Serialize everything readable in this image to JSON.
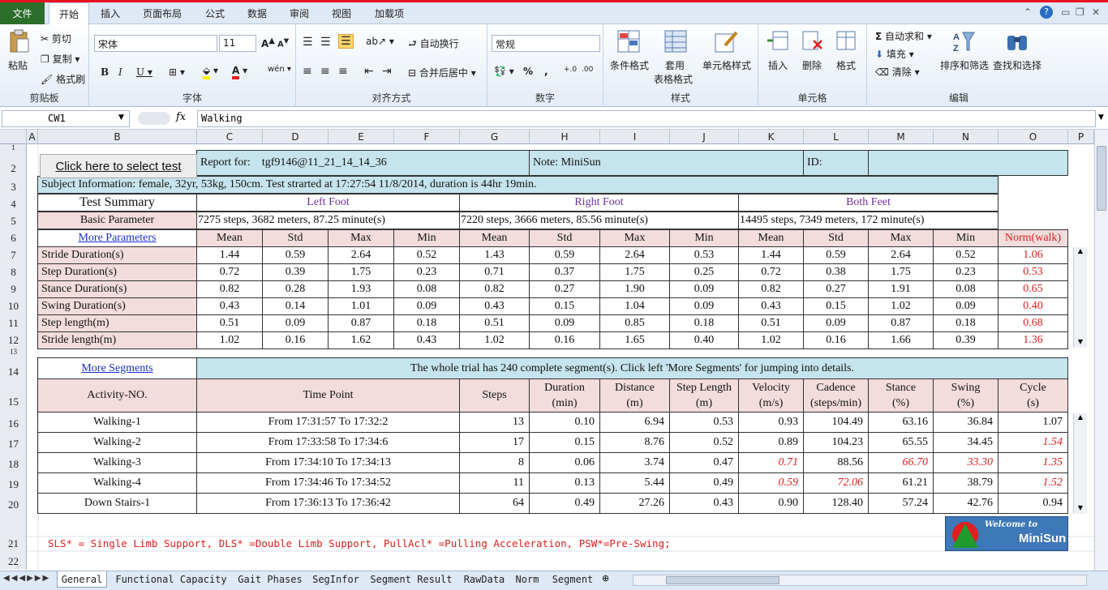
{
  "ribbon": {
    "file_tab": "文件",
    "tabs": [
      "开始",
      "插入",
      "页面布局",
      "公式",
      "数据",
      "审阅",
      "视图",
      "加载项"
    ],
    "clipboard": {
      "paste": "粘贴",
      "cut": "剪切",
      "copy": "复制",
      "format_painter": "格式刷",
      "group": "剪贴板"
    },
    "font": {
      "name": "宋体",
      "size": "11",
      "group": "字体"
    },
    "align": {
      "wrap": "自动换行",
      "merge": "合并后居中",
      "group": "对齐方式"
    },
    "number": {
      "format": "常规",
      "group": "数字"
    },
    "styles": {
      "cond": "条件格式",
      "table1": "套用",
      "table2": "表格格式",
      "cell": "单元格样式",
      "group": "样式"
    },
    "cells": {
      "insert": "插入",
      "delete": "删除",
      "format": "格式",
      "group": "单元格"
    },
    "editing": {
      "autosum": "自动求和",
      "fill": "填充",
      "clear": "清除",
      "sort": "排序和筛选",
      "find": "查找和选择",
      "group": "编辑"
    }
  },
  "formula_bar": {
    "name_box": "CW1",
    "fx": "fx",
    "value": "Walking"
  },
  "columns": [
    "A",
    "B",
    "C",
    "D",
    "E",
    "F",
    "G",
    "H",
    "I",
    "J",
    "K",
    "L",
    "M",
    "N",
    "O",
    "P"
  ],
  "rows": [
    "1",
    "2",
    "3",
    "4",
    "5",
    "6",
    "7",
    "8",
    "9",
    "10",
    "11",
    "12",
    "13",
    "14",
    "15",
    "16",
    "17",
    "18",
    "19",
    "20",
    "21",
    "22"
  ],
  "sheet": {
    "select_button": "Click here to select test",
    "report_for_label": "Report for:",
    "report_for_value": "tgf9146@11_21_14_14_36",
    "note": "Note: MiniSun",
    "id": "ID:",
    "subject_info": "Subject Information:  female, 32yr, 53kg, 150cm.   Test strarted at 17:27:54 11/8/2014, duration is  44hr 19min.",
    "test_summary": "Test Summary",
    "left_foot": "Left Foot",
    "right_foot": "Right Foot",
    "both_feet": "Both Feet",
    "basic_parameter": "Basic Parameter",
    "left_basic": "7275 steps, 3682 meters,  87.25 minute(s)",
    "right_basic": "7220 steps, 3666 meters, 85.56 minute(s)",
    "both_basic": "14495 steps, 7349 meters, 172 minute(s)",
    "more_parameters": "More Parameters",
    "stat_headers": [
      "Mean",
      "Std",
      "Max",
      "Min",
      "Mean",
      "Std",
      "Max",
      "Min",
      "Mean",
      "Std",
      "Max",
      "Min"
    ],
    "norm_header": "Norm(walk)",
    "params": [
      {
        "name": "Stride Duration(s)",
        "vals": [
          "1.44",
          "0.59",
          "2.64",
          "0.52",
          "1.43",
          "0.59",
          "2.64",
          "0.53",
          "1.44",
          "0.59",
          "2.64",
          "0.52"
        ],
        "norm": "1.06"
      },
      {
        "name": "Step Duration(s)",
        "vals": [
          "0.72",
          "0.39",
          "1.75",
          "0.23",
          "0.71",
          "0.37",
          "1.75",
          "0.25",
          "0.72",
          "0.38",
          "1.75",
          "0.23"
        ],
        "norm": "0.53"
      },
      {
        "name": "Stance Duration(s)",
        "vals": [
          "0.82",
          "0.28",
          "1.93",
          "0.08",
          "0.82",
          "0.27",
          "1.90",
          "0.09",
          "0.82",
          "0.27",
          "1.91",
          "0.08"
        ],
        "norm": "0.65"
      },
      {
        "name": "Swing Duration(s)",
        "vals": [
          "0.43",
          "0.14",
          "1.01",
          "0.09",
          "0.43",
          "0.15",
          "1.04",
          "0.09",
          "0.43",
          "0.15",
          "1.02",
          "0.09"
        ],
        "norm": "0.40"
      },
      {
        "name": "Step length(m)",
        "vals": [
          "0.51",
          "0.09",
          "0.87",
          "0.18",
          "0.51",
          "0.09",
          "0.85",
          "0.18",
          "0.51",
          "0.09",
          "0.87",
          "0.18"
        ],
        "norm": "0.68"
      },
      {
        "name": "Stride length(m)",
        "vals": [
          "1.02",
          "0.16",
          "1.62",
          "0.43",
          "1.02",
          "0.16",
          "1.65",
          "0.40",
          "1.02",
          "0.16",
          "1.66",
          "0.39"
        ],
        "norm": "1.36"
      }
    ],
    "more_segments": "More Segments",
    "segments_msg": "The whole trial has 240 complete segment(s). Click left 'More Segments' for jumping into details.",
    "seg_headers": {
      "activity": "Activity-NO.",
      "time": "Time Point",
      "steps": "Steps",
      "duration": [
        "Duration",
        "(min)"
      ],
      "distance": [
        "Distance",
        "(m)"
      ],
      "step_length": [
        "Step Length",
        "(m)"
      ],
      "velocity": [
        "Velocity",
        "(m/s)"
      ],
      "cadence": [
        "Cadence",
        "(steps/min)"
      ],
      "stance": [
        "Stance",
        "(%)"
      ],
      "swing": [
        "Swing",
        "(%)"
      ],
      "cycle": [
        "Cycle",
        "(s)"
      ]
    },
    "segments": [
      {
        "activity": "Walking-1",
        "time": "From 17:31:57 To 17:32:2",
        "steps": "13",
        "duration": "0.10",
        "distance": "6.94",
        "step_length": "0.53",
        "velocity": "0.93",
        "cadence": "104.49",
        "stance": "63.16",
        "swing": "36.84",
        "cycle": "1.07",
        "flags": []
      },
      {
        "activity": "Walking-2",
        "time": "From 17:33:58 To 17:34:6",
        "steps": "17",
        "duration": "0.15",
        "distance": "8.76",
        "step_length": "0.52",
        "velocity": "0.89",
        "cadence": "104.23",
        "stance": "65.55",
        "swing": "34.45",
        "cycle": "1.54",
        "flags": [
          "cycle"
        ]
      },
      {
        "activity": "Walking-3",
        "time": "From 17:34:10 To 17:34:13",
        "steps": "8",
        "duration": "0.06",
        "distance": "3.74",
        "step_length": "0.47",
        "velocity": "0.71",
        "cadence": "88.56",
        "stance": "66.70",
        "swing": "33.30",
        "cycle": "1.35",
        "flags": [
          "velocity",
          "stance",
          "swing",
          "cycle"
        ]
      },
      {
        "activity": "Walking-4",
        "time": "From 17:34:46 To 17:34:52",
        "steps": "11",
        "duration": "0.13",
        "distance": "5.44",
        "step_length": "0.49",
        "velocity": "0.59",
        "cadence": "72.06",
        "stance": "61.21",
        "swing": "38.79",
        "cycle": "1.52",
        "flags": [
          "velocity",
          "cadence",
          "cycle"
        ]
      },
      {
        "activity": "Down Stairs-1",
        "time": "From 17:36:13 To 17:36:42",
        "steps": "64",
        "duration": "0.49",
        "distance": "27.26",
        "step_length": "0.43",
        "velocity": "0.90",
        "cadence": "128.40",
        "stance": "57.24",
        "swing": "42.76",
        "cycle": "0.94",
        "flags": []
      }
    ],
    "footnote": "SLS* = Single Limb Support, DLS* =Double Limb Support, PullAcl* =Pulling Acceleration,  PSW*=Pre-Swing;",
    "logo_welcome": "Welcome to",
    "logo_name": "MiniSun"
  },
  "sheet_tabs": [
    "General",
    "Functional Capacity",
    "Gait Phases",
    "SegInfor",
    "Segment Result",
    "RawData",
    "Norm",
    "Segment"
  ],
  "colors": {
    "accent": "#2a6e2a",
    "blue_cell": "#c6e4ed",
    "pink_cell": "#f3dcdc",
    "red_text": "#e02020",
    "purple_text": "#7030a0"
  }
}
